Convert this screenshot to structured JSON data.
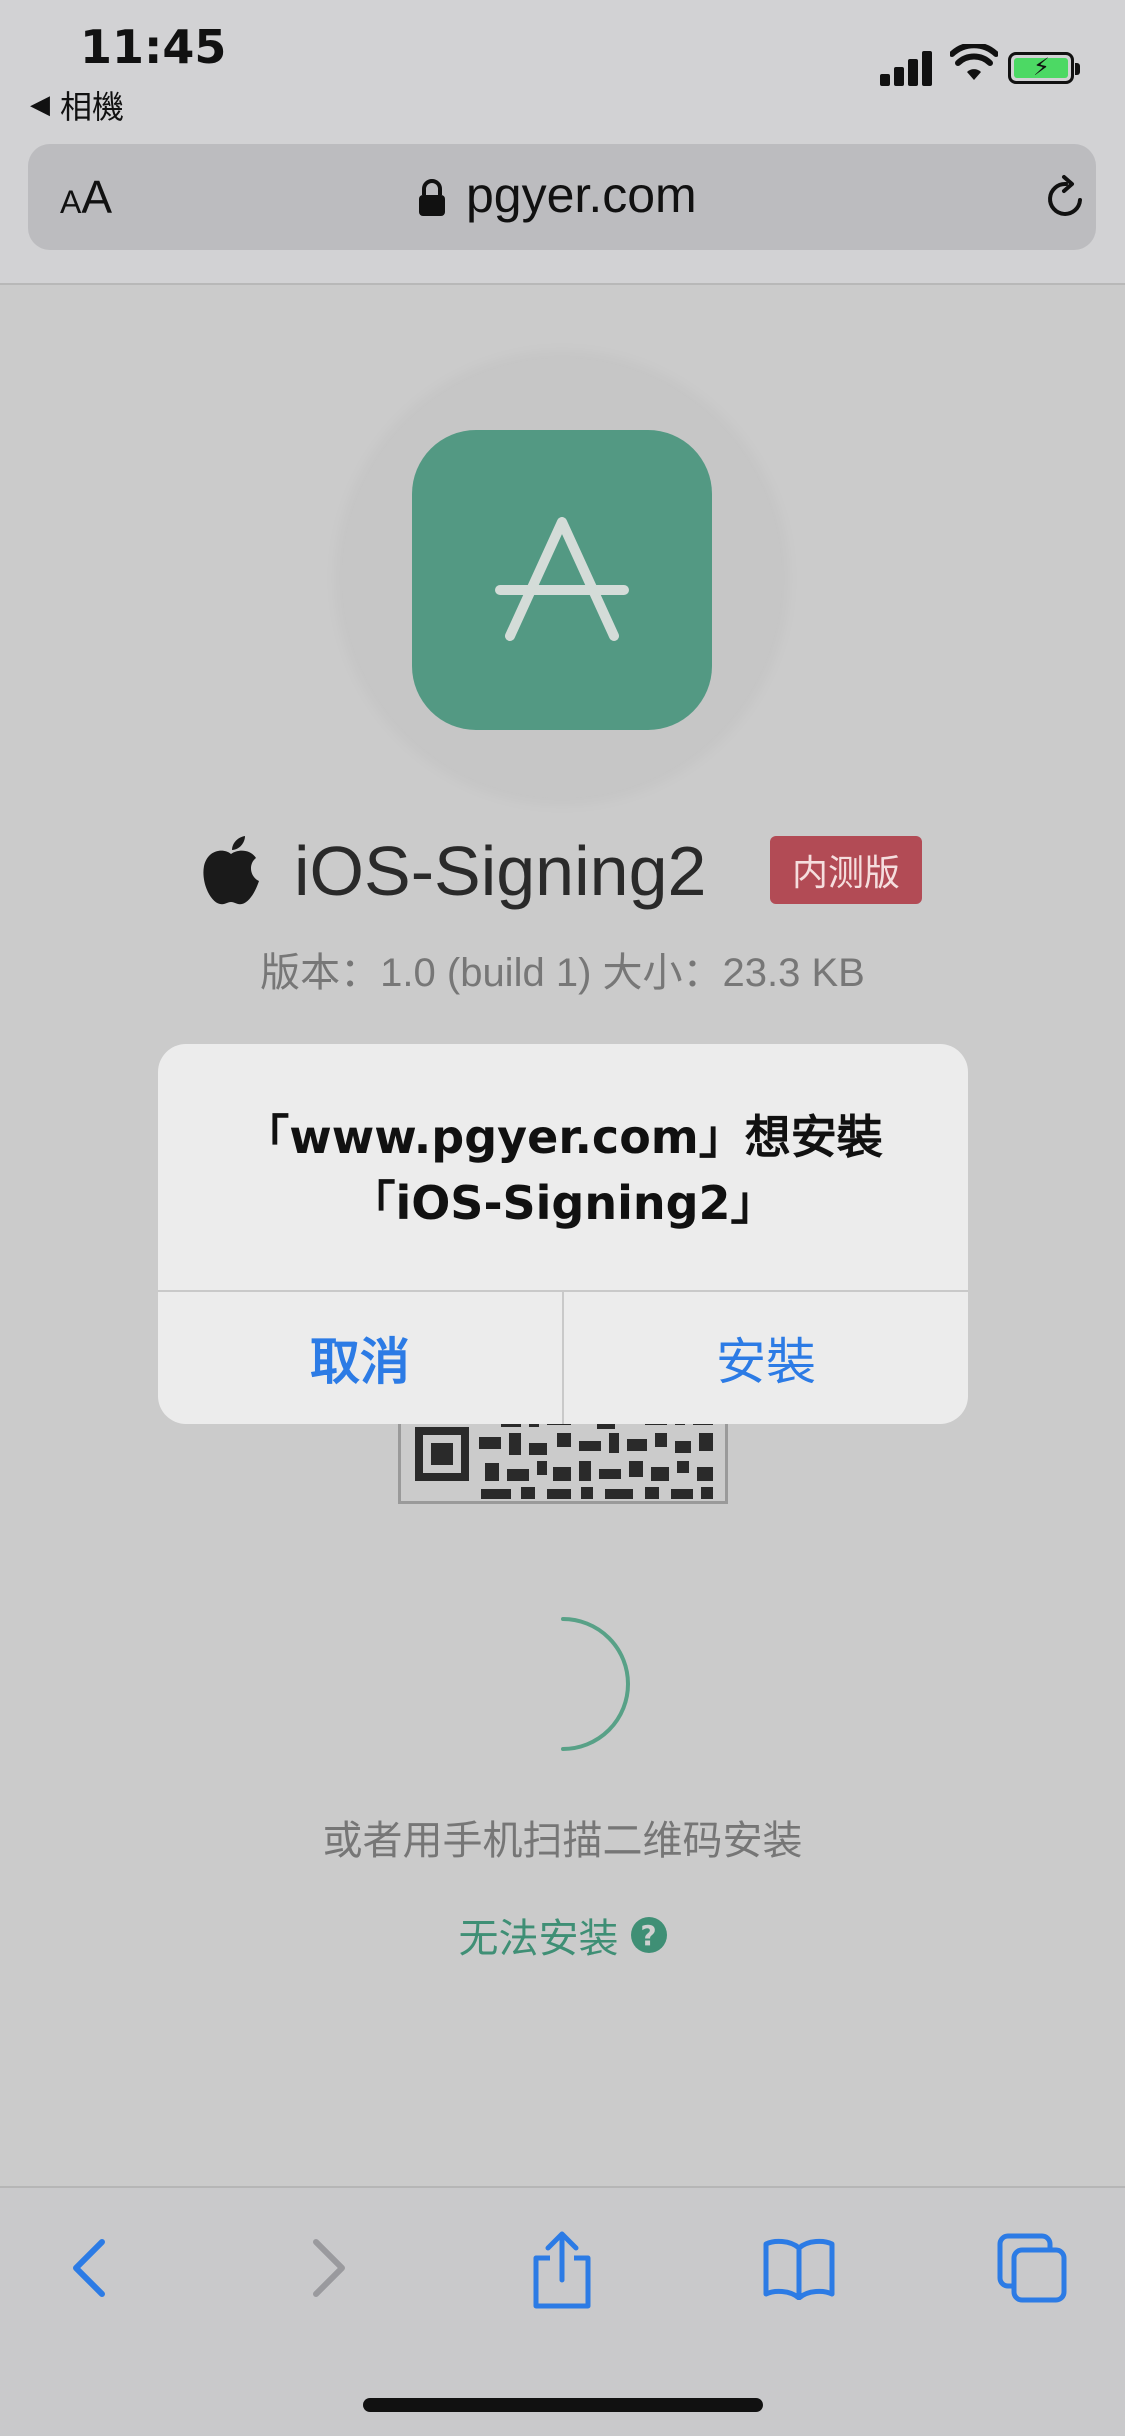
{
  "status_bar": {
    "time": "11:45",
    "back_app": "相機",
    "back_arrow": "◀"
  },
  "address_bar": {
    "text_size_small": "A",
    "text_size_large": "A",
    "domain": "pgyer.com"
  },
  "app": {
    "name": "iOS-Signing2",
    "badge": "内测版",
    "meta": "版本：1.0 (build 1)    大小：23.3 KB",
    "icon_color": "#539983"
  },
  "page": {
    "scan_hint": "或者用手机扫描二维码安装",
    "help_link": "无法安装",
    "help_icon_glyph": "?"
  },
  "alert": {
    "title_line1": "「www.pgyer.com」想安裝",
    "title_line2": "「iOS-Signing2」",
    "cancel_label": "取消",
    "install_label": "安裝",
    "button_color": "#2c7be5"
  },
  "toolbar": {
    "icons": [
      "back-icon",
      "forward-icon",
      "share-icon",
      "bookmarks-icon",
      "tabs-icon"
    ]
  }
}
